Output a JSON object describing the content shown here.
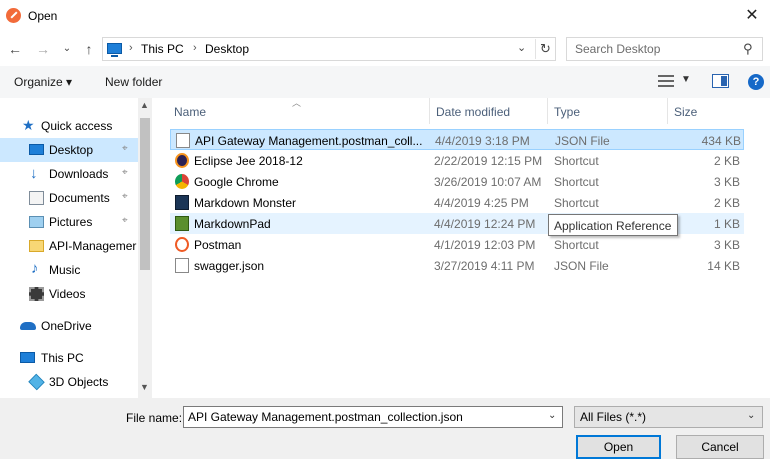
{
  "window": {
    "title": "Open",
    "close_glyph": "✕"
  },
  "address": {
    "back_glyph": "←",
    "forward_glyph": "→",
    "recent_glyph": "⌄",
    "up_glyph": "↑",
    "crumbs": [
      "This PC",
      "Desktop"
    ],
    "crumb_separator": "›",
    "dropdown_glyph": "⌄",
    "refresh_glyph": "↻"
  },
  "search": {
    "placeholder": "Search Desktop",
    "icon": "search-icon"
  },
  "toolbar": {
    "organize_label": "Organize ▾",
    "new_folder_label": "New folder",
    "view_dropdown_glyph": "▼",
    "help_glyph": "?"
  },
  "nav": {
    "items": [
      {
        "label": "Quick access",
        "icon": "star-icon",
        "pinned": false
      },
      {
        "label": "Desktop",
        "icon": "desktop-icon",
        "pinned": true,
        "selected": true
      },
      {
        "label": "Downloads",
        "icon": "download-icon",
        "pinned": true
      },
      {
        "label": "Documents",
        "icon": "documents-icon",
        "pinned": true
      },
      {
        "label": "Pictures",
        "icon": "pictures-icon",
        "pinned": true
      },
      {
        "label": "API-Managemer",
        "icon": "folder-icon",
        "pinned": false
      },
      {
        "label": "Music",
        "icon": "music-icon",
        "pinned": false
      },
      {
        "label": "Videos",
        "icon": "videos-icon",
        "pinned": false
      },
      {
        "label": "OneDrive",
        "icon": "cloud-icon",
        "pinned": false
      },
      {
        "label": "This PC",
        "icon": "pc-icon",
        "pinned": false
      },
      {
        "label": "3D Objects",
        "icon": "cube-icon",
        "pinned": false
      }
    ],
    "pin_glyph": "📌"
  },
  "columns": {
    "name": "Name",
    "date": "Date modified",
    "type": "Type",
    "size": "Size"
  },
  "files": [
    {
      "name": "API Gateway Management.postman_coll...",
      "date": "4/4/2019 3:18 PM",
      "type": "JSON File",
      "size": "434 KB",
      "icon": "file-icon",
      "selected": true
    },
    {
      "name": "Eclipse Jee 2018-12",
      "date": "2/22/2019 12:15 PM",
      "type": "Shortcut",
      "size": "2 KB",
      "icon": "eclipse-icon"
    },
    {
      "name": "Google Chrome",
      "date": "3/26/2019 10:07 AM",
      "type": "Shortcut",
      "size": "3 KB",
      "icon": "chrome-icon"
    },
    {
      "name": "Markdown Monster",
      "date": "4/4/2019 4:25 PM",
      "type": "Shortcut",
      "size": "2 KB",
      "icon": "markdown-monster-icon"
    },
    {
      "name": "MarkdownPad",
      "date": "4/4/2019 12:24 PM",
      "type": "Application Reference",
      "size": "1 KB",
      "icon": "markdownpad-icon",
      "hovered": true
    },
    {
      "name": "Postman",
      "date": "4/1/2019 12:03 PM",
      "type": "Shortcut",
      "size": "3 KB",
      "icon": "postman-icon"
    },
    {
      "name": "swagger.json",
      "date": "3/27/2019 4:11 PM",
      "type": "JSON File",
      "size": "14 KB",
      "icon": "file-icon"
    }
  ],
  "tooltip": "Application Reference",
  "bottom": {
    "filename_label": "File name:",
    "filename_value": "API Gateway Management.postman_collection.json",
    "filter_value": "All Files (*.*)",
    "dropdown_glyph": "⌄",
    "open_label": "Open",
    "cancel_label": "Cancel"
  },
  "colors": {
    "selection": "#cce8ff",
    "accent": "#0078d7",
    "header_text": "#4c607a"
  }
}
